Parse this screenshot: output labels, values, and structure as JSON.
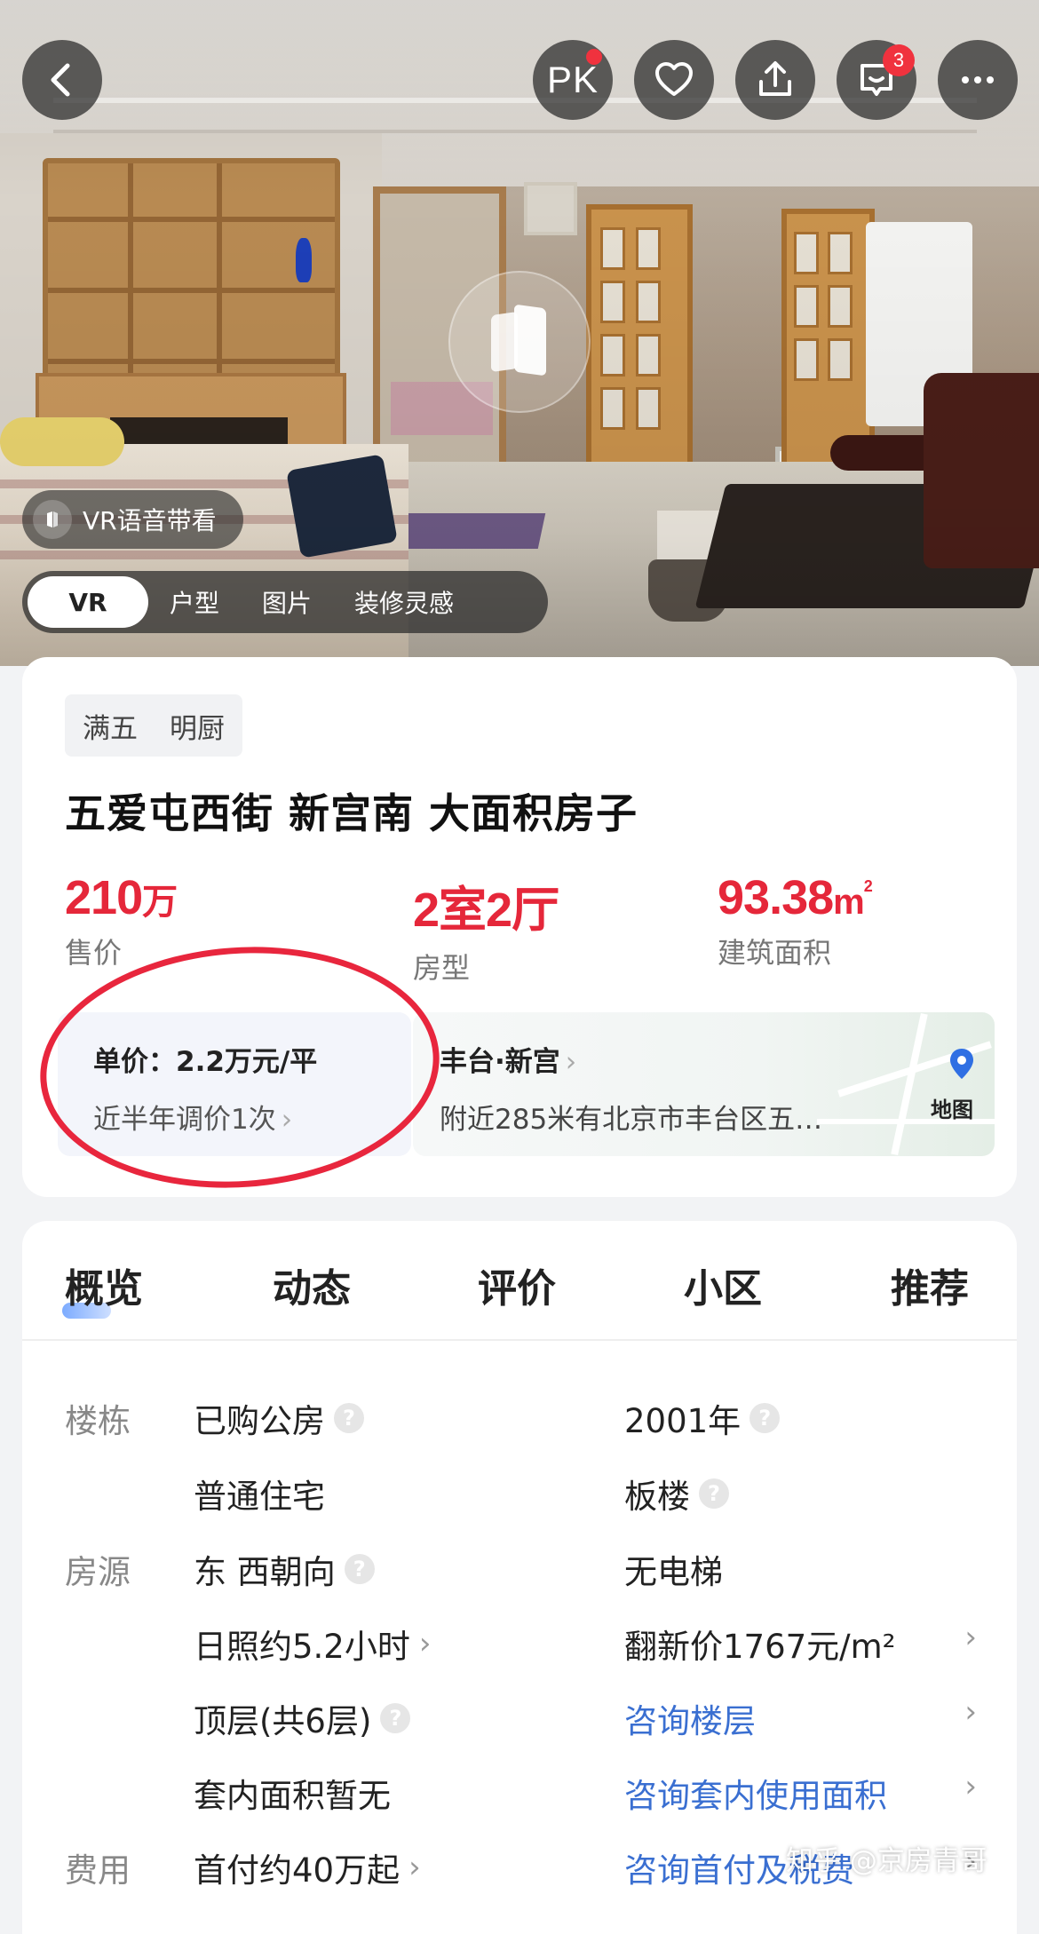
{
  "hero": {
    "pk_label": "PK",
    "message_count": "3",
    "vr_voice_label": "VR语音带看",
    "media_tabs": [
      "VR",
      "户型",
      "图片",
      "装修灵感"
    ]
  },
  "listing": {
    "tags": [
      "满五",
      "明厨"
    ],
    "title": "五爱屯西街 新宫南 大面积房子",
    "price": {
      "value": "210",
      "unit": "万",
      "label": "售价"
    },
    "layout": {
      "value": "2室2厅",
      "label": "房型"
    },
    "area": {
      "value": "93.38",
      "unit": "m",
      "sup": "2",
      "label": "建筑面积"
    },
    "unit_price": {
      "label": "单价：2.2万元/平",
      "sub": "近半年调价1次"
    },
    "location": {
      "district": "丰台·新宫",
      "nearby": "附近285米有北京市丰台区五…",
      "map_label": "地图"
    }
  },
  "nav": {
    "tabs": [
      "概览",
      "动态",
      "评价",
      "小区",
      "推荐"
    ]
  },
  "details": {
    "rows": [
      {
        "cat": "楼栋",
        "c1": "已购公房",
        "c1_help": true,
        "c2": "2001年",
        "c2_help": true
      },
      {
        "cat": "",
        "c1": "普通住宅",
        "c2": "板楼",
        "c2_help": true
      },
      {
        "cat": "房源",
        "c1": "东 西朝向",
        "c1_help": true,
        "c2": "无电梯"
      },
      {
        "cat": "",
        "c1": "日照约5.2小时",
        "c1_arrow": true,
        "c2": "翻新价1767元/m²",
        "row_arrow": true
      },
      {
        "cat": "",
        "c1": "顶层(共6层)",
        "c1_help": true,
        "c2": "咨询楼层",
        "c2_link": true,
        "row_arrow": true
      },
      {
        "cat": "",
        "c1": "套内面积暂无",
        "c2": "咨询套内使用面积",
        "c2_link": true,
        "row_arrow": true
      },
      {
        "cat": "费用",
        "c1": "首付约40万起",
        "c1_arrow": true,
        "c2": "咨询首付及税费",
        "c2_link": true,
        "row_arrow": true
      }
    ]
  },
  "watermark": "知乎 @京房青哥",
  "colors": {
    "accent_red": "#e5273a",
    "link_blue": "#3a6fd1"
  }
}
